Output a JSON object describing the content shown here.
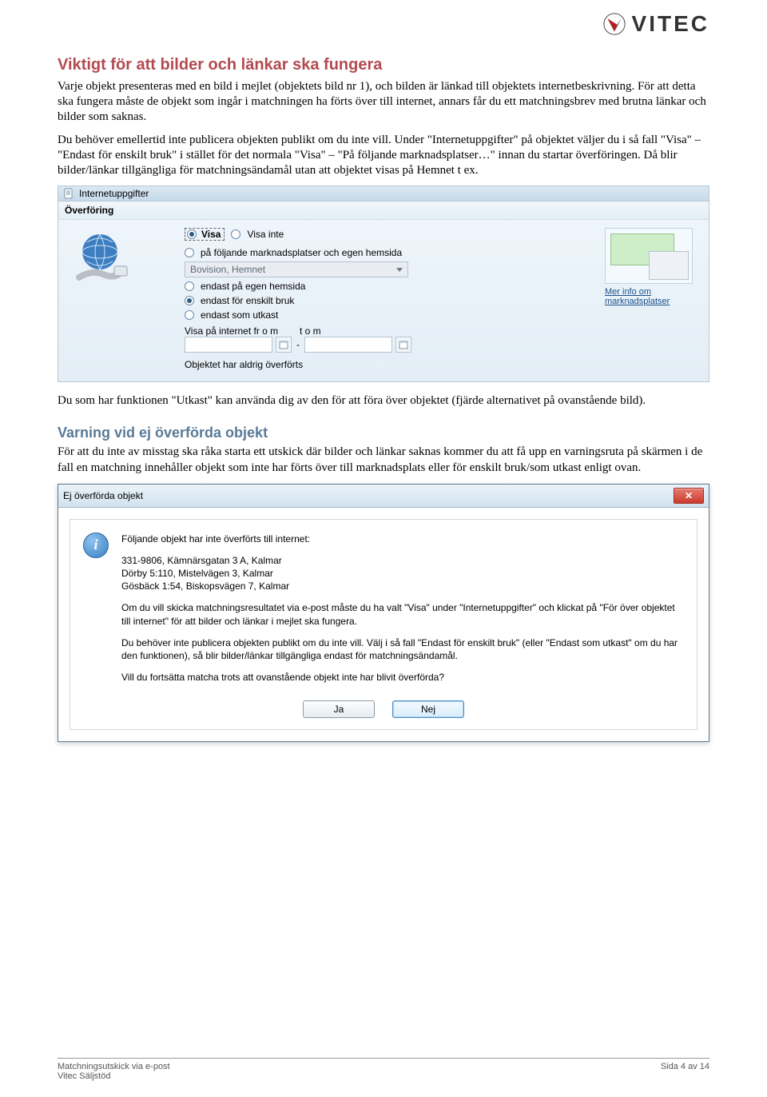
{
  "brand": {
    "name": "VITEC"
  },
  "h1": "Viktigt för att bilder och länkar ska fungera",
  "p1": "Varje objekt presenteras med en bild i mejlet (objektets bild nr 1), och bilden är länkad till objektets internetbeskrivning. För att detta ska fungera måste de objekt som ingår i matchningen ha förts över till internet, annars får du ett matchningsbrev med brutna länkar och bilder som saknas.",
  "p2": "Du behöver emellertid inte publicera objekten publikt om du inte vill. Under \"Internetuppgifter\" på objektet väljer du i så fall \"Visa\" – \"Endast för enskilt bruk\" i stället för det normala \"Visa\" – \"På följande marknadsplatser…\" innan du startar överföringen. Då blir bilder/länkar tillgängliga för matchningsändamål utan att objektet visas på Hemnet t ex.",
  "panel1": {
    "header_tab": "Internetuppgifter",
    "section": "Överföring",
    "radio_visa": "Visa",
    "radio_visainte": "Visa inte",
    "opt_following": "på följande marknadsplatser och egen hemsida",
    "dropdown_value": "Bovision, Hemnet",
    "opt_own": "endast på egen hemsida",
    "opt_enskilt": "endast för enskilt bruk",
    "opt_utkast": "endast som utkast",
    "label_from": "Visa på internet fr o m",
    "label_to": "t o m",
    "status": "Objektet har aldrig överförts",
    "right_link1": "Mer info om",
    "right_link2": "marknadsplatser"
  },
  "p3": "Du som har funktionen \"Utkast\" kan använda dig av den för att föra över objektet (fjärde alternativet på ovanstående bild).",
  "h2": "Varning vid ej överförda objekt",
  "p4": "För att du inte av misstag ska råka starta ett utskick där bilder och länkar saknas kommer du att få upp en varningsruta på skärmen i de fall en matchning innehåller objekt som inte har förts över till marknadsplats eller för enskilt bruk/som utkast enligt ovan.",
  "panel2": {
    "title": "Ej överförda objekt",
    "line1": "Följande objekt har inte överförts till internet:",
    "line2": "331-9806, Kämnärsgatan 3 A, Kalmar",
    "line3": "Dörby 5:110, Mistelvägen 3, Kalmar",
    "line4": "Gösbäck 1:54, Biskopsvägen 7, Kalmar",
    "line5": "Om du vill skicka matchningsresultatet via e-post måste du ha valt \"Visa\" under \"Internetuppgifter\" och klickat på \"För över objektet till internet\" för att bilder och länkar i mejlet ska fungera.",
    "line6": "Du behöver inte publicera objekten publikt om du inte vill. Välj i så fall \"Endast för enskilt bruk\" (eller \"Endast som utkast\" om du har den funktionen), så blir bilder/länkar tillgängliga endast för matchningsändamål.",
    "line7": "Vill du fortsätta matcha trots att ovanstående objekt inte har blivit överförda?",
    "btn_yes": "Ja",
    "btn_no": "Nej"
  },
  "footer": {
    "left1": "Matchningsutskick via e-post",
    "left2": "Vitec Säljstöd",
    "right": "Sida 4 av 14"
  }
}
